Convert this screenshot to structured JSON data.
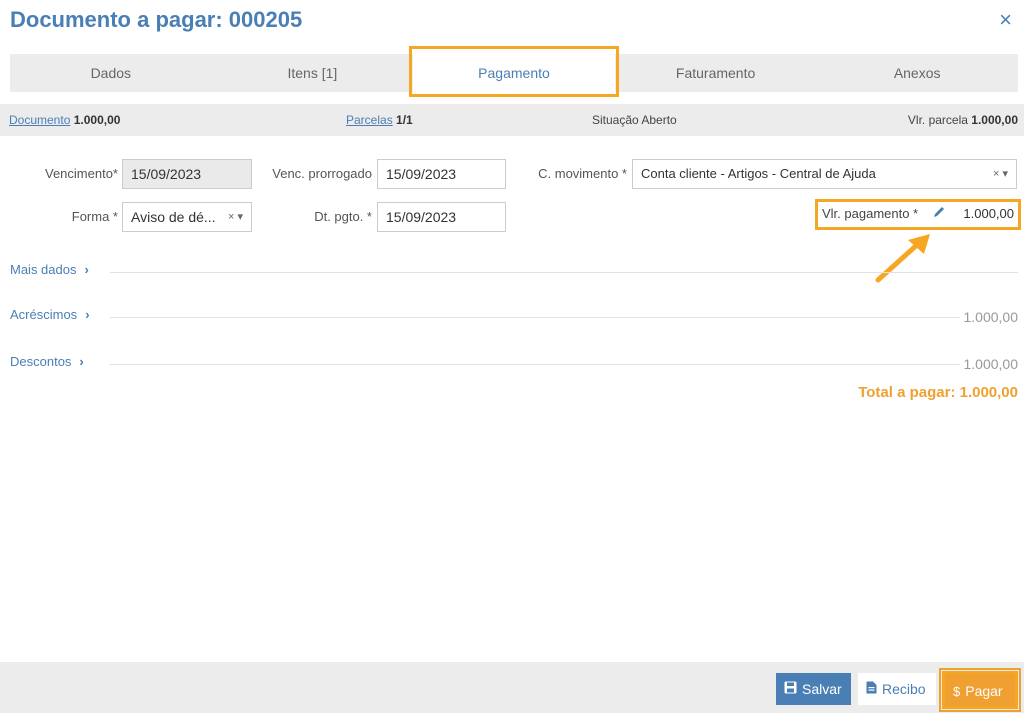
{
  "header": {
    "title": "Documento a pagar: 000205",
    "close_icon": "×"
  },
  "tabs": [
    {
      "label": "Dados"
    },
    {
      "label": "Itens [1]"
    },
    {
      "label": "Pagamento"
    },
    {
      "label": "Faturamento"
    },
    {
      "label": "Anexos"
    }
  ],
  "summary": {
    "documento_link": "Documento",
    "documento_value": "1.000,00",
    "parcelas_link": "Parcelas",
    "parcelas_value": "1/1",
    "situacao_label": "Situação",
    "situacao_value": "Aberto",
    "vlr_parcela_label": "Vlr. parcela",
    "vlr_parcela_value": "1.000,00"
  },
  "form": {
    "vencimento_label": "Vencimento*",
    "vencimento_value": "15/09/2023",
    "venc_prorrogado_label": "Venc. prorrogado",
    "venc_prorrogado_value": "15/09/2023",
    "c_movimento_label": "C. movimento *",
    "c_movimento_value": "Conta cliente - Artigos - Central de Ajuda",
    "forma_label": "Forma *",
    "forma_value": "Aviso de dé...",
    "dt_pgto_label": "Dt. pgto. *",
    "dt_pgto_value": "15/09/2023",
    "vlr_pagamento_label": "Vlr. pagamento *",
    "vlr_pagamento_value": "1.000,00",
    "clear_glyph": "×",
    "dropdown_glyph": "▾"
  },
  "sections": {
    "mais_dados": {
      "label": "Mais dados",
      "chevron": "›"
    },
    "acrescimos": {
      "label": "Acréscimos",
      "chevron": "›",
      "value": "1.000,00"
    },
    "descontos": {
      "label": "Descontos",
      "chevron": "›",
      "value": "1.000,00"
    }
  },
  "total": {
    "label": "Total a pagar: 1.000,00"
  },
  "footer": {
    "salvar_label": "Salvar",
    "recibo_label": "Recibo",
    "pagar_label": "Pagar",
    "pagar_symbol": "$"
  },
  "colors": {
    "accent": "#4a7fb5",
    "highlight": "#f5a623",
    "pay": "#f0a030"
  },
  "icons": {
    "close": "close-icon",
    "edit": "pencil-icon",
    "save": "floppy-icon",
    "receipt": "document-icon",
    "dollar": "dollar-icon"
  }
}
